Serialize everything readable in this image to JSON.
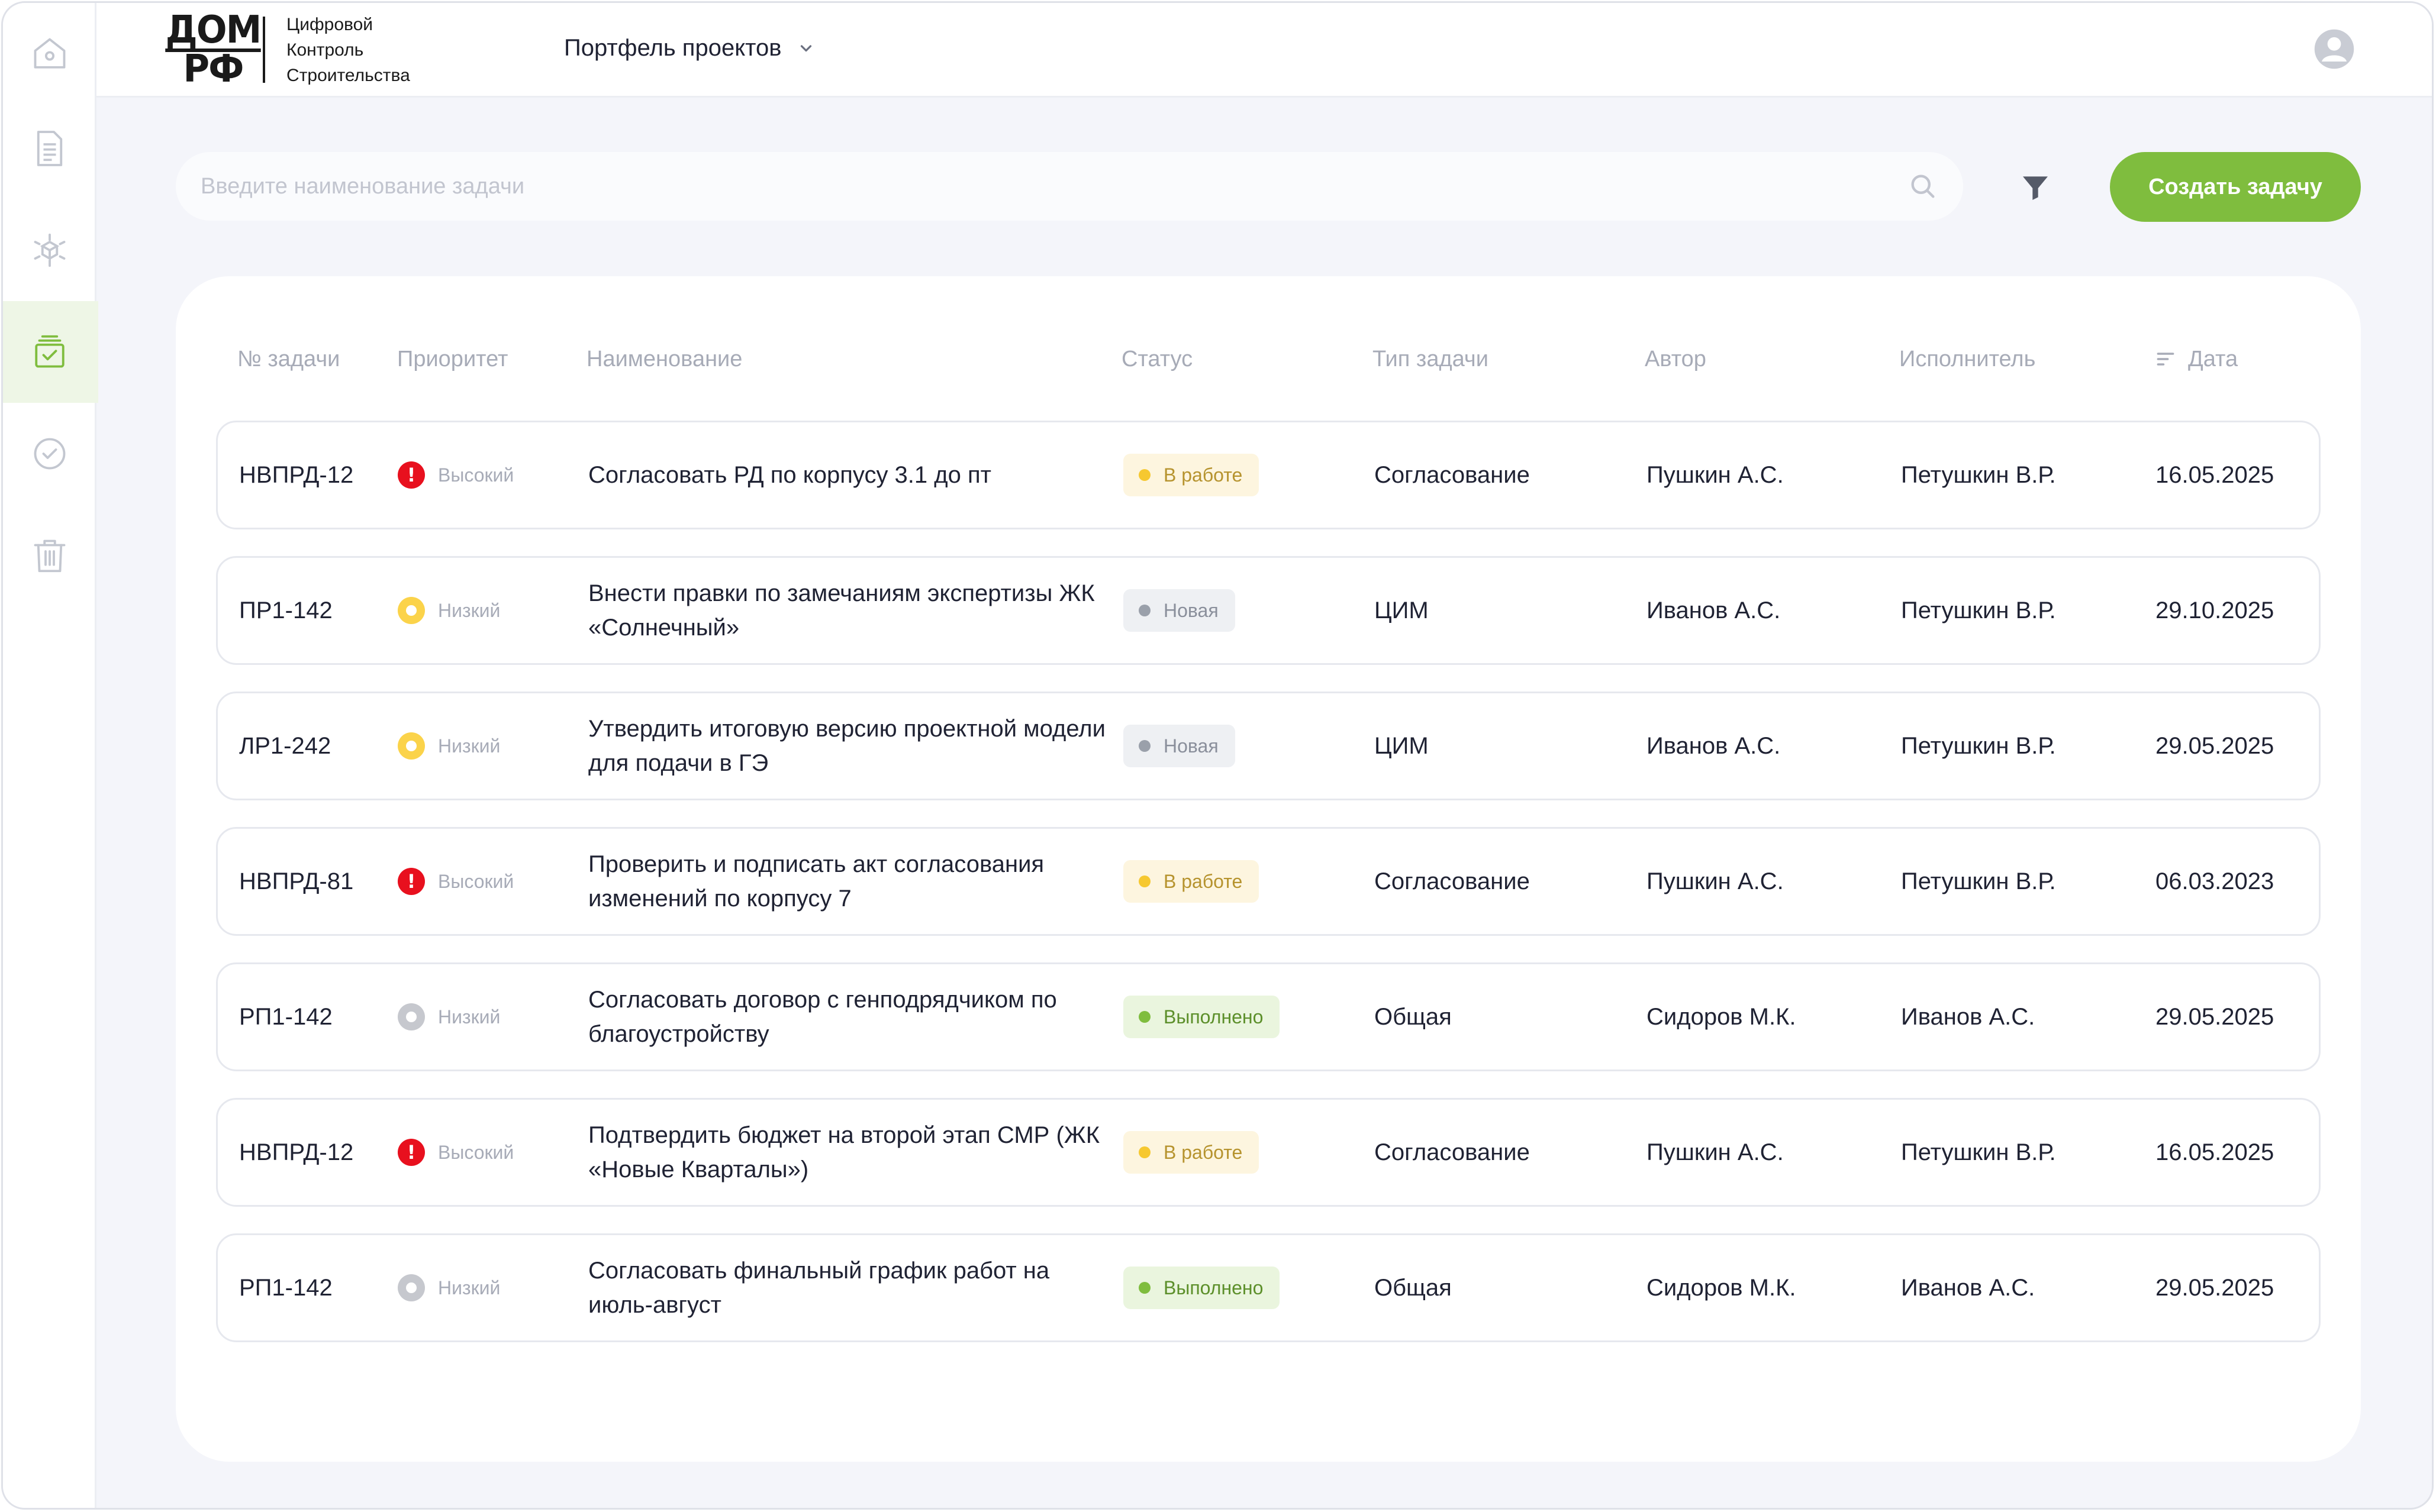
{
  "header": {
    "logo_top": "ДОМ",
    "logo_bottom": "РФ",
    "logo_lines": [
      "Цифровой",
      "Контроль",
      "Строительства"
    ],
    "portfolio_label": "Портфель проектов"
  },
  "sidebar": {
    "items": [
      {
        "icon": "home-icon"
      },
      {
        "icon": "document-icon"
      },
      {
        "icon": "model-3d-icon"
      },
      {
        "icon": "tasks-icon",
        "active": true
      },
      {
        "icon": "check-circle-icon"
      },
      {
        "icon": "trash-icon"
      }
    ]
  },
  "search": {
    "placeholder": "Введите наименование задачи"
  },
  "actions": {
    "create_label": "Создать задачу"
  },
  "table": {
    "columns": {
      "id": "№ задачи",
      "priority": "Приоритет",
      "name": "Наименование",
      "status": "Статус",
      "type": "Тип задачи",
      "author": "Автор",
      "assignee": "Исполнитель",
      "date": "Дата"
    },
    "rows": [
      {
        "id": "НВПРД-12",
        "priority": "Высокий",
        "priority_level": "high",
        "name": "Согласовать РД по корпусу 3.1 до пт",
        "status": "В работе",
        "status_kind": "work",
        "type": "Согласование",
        "author": "Пушкин А.С.",
        "assignee": "Петушкин  В.Р.",
        "date": "16.05.2025"
      },
      {
        "id": "ПР1-142",
        "priority": "Низкий",
        "priority_level": "low",
        "name": "Внести правки по замечаниям экспертизы ЖК «Солнечный»",
        "status": "Новая",
        "status_kind": "new",
        "type": "ЦИМ",
        "author": "Иванов А.С.",
        "assignee": "Петушкин  В.Р.",
        "date": "29.10.2025"
      },
      {
        "id": "ЛР1-242",
        "priority": "Низкий",
        "priority_level": "low",
        "name": "Утвердить итоговую версию проектной модели для подачи в ГЭ",
        "status": "Новая",
        "status_kind": "new",
        "type": "ЦИМ",
        "author": "Иванов А.С.",
        "assignee": "Петушкин  В.Р.",
        "date": "29.05.2025"
      },
      {
        "id": "НВПРД-81",
        "priority": "Высокий",
        "priority_level": "high",
        "name": "Проверить и подписать акт согласования изменений по корпусу 7",
        "status": "В работе",
        "status_kind": "work",
        "type": "Согласование",
        "author": "Пушкин А.С.",
        "assignee": "Петушкин  В.Р.",
        "date": "06.03.2023"
      },
      {
        "id": "РП1-142",
        "priority": "Низкий",
        "priority_level": "none",
        "name": "Согласовать договор с генподрядчиком по благоустройству",
        "status": "Выполнено",
        "status_kind": "done",
        "type": "Общая",
        "author": "Сидоров М.К.",
        "assignee": "Иванов А.С.",
        "date": "29.05.2025"
      },
      {
        "id": "НВПРД-12",
        "priority": "Высокий",
        "priority_level": "high",
        "name": "Подтвердить бюджет на второй этап СМР (ЖК «Новые Кварталы»)",
        "status": "В работе",
        "status_kind": "work",
        "type": "Согласование",
        "author": "Пушкин А.С.",
        "assignee": "Петушкин  В.Р.",
        "date": "16.05.2025"
      },
      {
        "id": "РП1-142",
        "priority": "Низкий",
        "priority_level": "none",
        "name": "Согласовать финальный график работ на июль-август",
        "status": "Выполнено",
        "status_kind": "done",
        "type": "Общая",
        "author": "Сидоров М.К.",
        "assignee": "Иванов А.С.",
        "date": "29.05.2025"
      }
    ]
  },
  "colors": {
    "accent": "#7fbd3e",
    "priority_high": "#e8101e",
    "priority_low": "#fbd34a",
    "priority_none": "#c6c8ce",
    "status_work_bg": "#fdf5df",
    "status_work_dot": "#f6c830",
    "status_new_bg": "#eef0f3",
    "status_new_dot": "#9aa0aa",
    "status_done_bg": "#eaf5de",
    "status_done_dot": "#7fbd3e"
  }
}
